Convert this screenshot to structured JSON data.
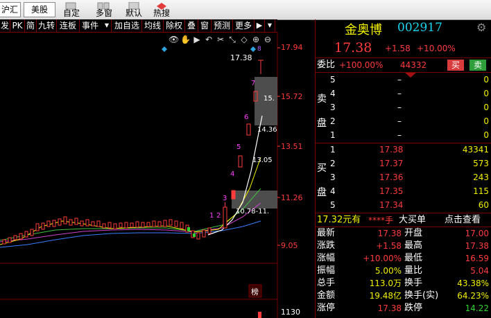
{
  "toolbar": {
    "left_partial": "沪汇",
    "meigu": "美股",
    "zixuan": "自定",
    "duochuang": "多窗",
    "moren": "默认",
    "resou": "热搜"
  },
  "chart_toolbar": {
    "items": [
      "发",
      "PK",
      "简",
      "九转",
      "连板",
      "事件",
      "加自选",
      "均线",
      "除权",
      "叠",
      "窗",
      "预测",
      "更多"
    ]
  },
  "price_axis": {
    "labels": [
      "17.94",
      "15.72",
      "13.51",
      "11.26",
      "9.05"
    ],
    "vol_label": "1130"
  },
  "chart_annotations": {
    "price_top": "17.38",
    "diamond_8": "8",
    "steps": [
      "1",
      "2",
      "3",
      "4",
      "5",
      "6",
      "7"
    ],
    "mid_15": "15.",
    "mid_1436": "14.36",
    "mid_1305": "13.05",
    "bottom_range": "10.78-11.",
    "bang": "榜"
  },
  "header": {
    "name": "金奥博",
    "code": "002917",
    "price": "17.38",
    "change": "+1.58",
    "pct": "+10.00%"
  },
  "weibi": {
    "label": "委比",
    "pct": "+100.00%",
    "value": "44332",
    "buy_btn": "买",
    "sell_btn": "卖"
  },
  "sell_side": {
    "label": "卖盘",
    "rows": [
      {
        "level": "5",
        "price": "–",
        "vol": "0"
      },
      {
        "level": "4",
        "price": "–",
        "vol": "0"
      },
      {
        "level": "3",
        "price": "–",
        "vol": "0"
      },
      {
        "level": "2",
        "price": "–",
        "vol": "0"
      },
      {
        "level": "1",
        "price": "–",
        "vol": "0"
      }
    ]
  },
  "buy_side": {
    "label": "买盘",
    "rows": [
      {
        "level": "1",
        "price": "17.38",
        "vol": "43341"
      },
      {
        "level": "2",
        "price": "17.37",
        "vol": "573"
      },
      {
        "level": "3",
        "price": "17.36",
        "vol": "243"
      },
      {
        "level": "4",
        "price": "17.35",
        "vol": "115"
      },
      {
        "level": "5",
        "price": "17.34",
        "vol": "60"
      }
    ]
  },
  "big_order": {
    "amount": "17.32元有",
    "mask": "****手",
    "label": "大买单",
    "link": "点击查看"
  },
  "stats": [
    {
      "l1": "最新",
      "v1": "17.38",
      "c1": "red",
      "l2": "开盘",
      "v2": "17.00",
      "c2": "red"
    },
    {
      "l1": "涨跌",
      "v1": "+1.58",
      "c1": "red",
      "l2": "最高",
      "v2": "17.38",
      "c2": "red"
    },
    {
      "l1": "涨幅",
      "v1": "+10.00%",
      "c1": "red",
      "l2": "最低",
      "v2": "16.59",
      "c2": "red"
    },
    {
      "l1": "振幅",
      "v1": "5.00%",
      "c1": "yel",
      "l2": "量比",
      "v2": "5.04",
      "c2": "red"
    },
    {
      "l1": "总手",
      "v1": "113.0万",
      "c1": "yel",
      "l2": "换手",
      "v2": "43.38%",
      "c2": "yel"
    },
    {
      "l1": "金额",
      "v1": "19.48亿",
      "c1": "yel",
      "l2": "换手(实)",
      "v2": "64.23%",
      "c2": "yel"
    },
    {
      "l1": "涨停",
      "v1": "17.38",
      "c1": "red",
      "l2": "跌停",
      "v2": "14.22",
      "c2": "grn"
    }
  ]
}
